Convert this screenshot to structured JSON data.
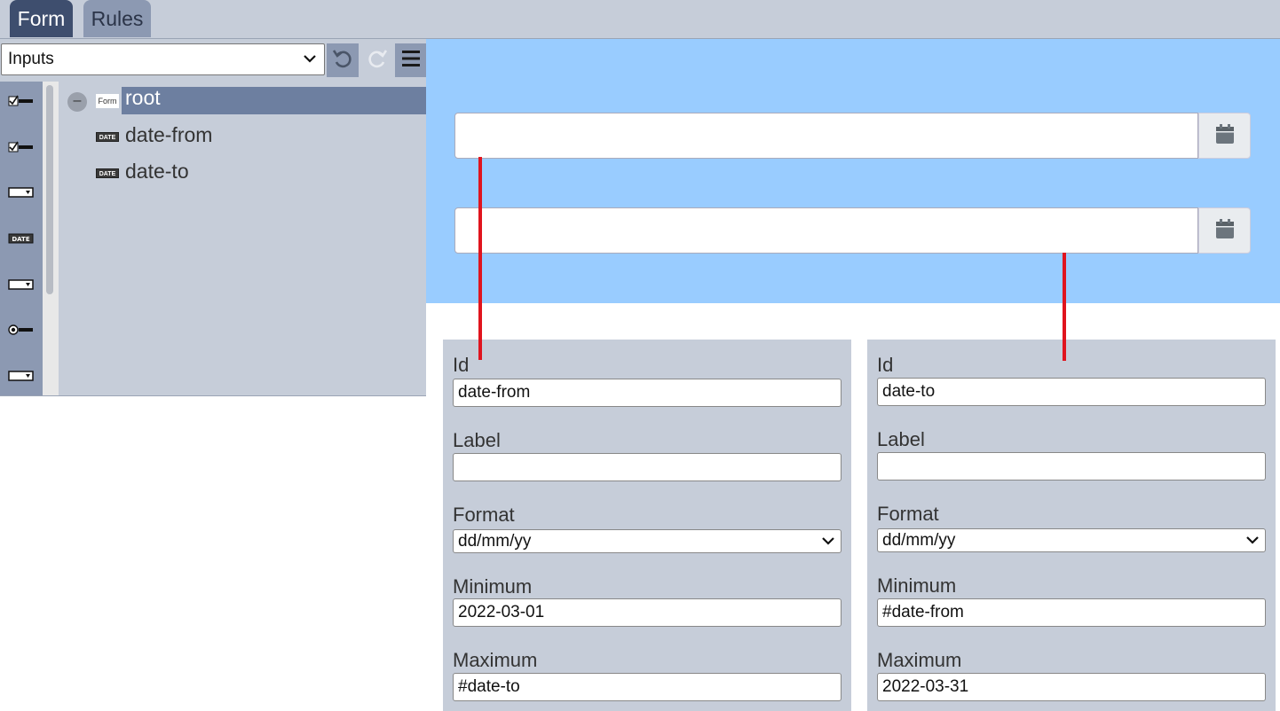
{
  "tabs": [
    {
      "label": "Form",
      "active": true
    },
    {
      "label": "Rules",
      "active": false
    }
  ],
  "toolbar": {
    "inputs_select": "Inputs",
    "undo_icon": "undo-icon",
    "redo_icon": "redo-icon",
    "menu_icon": "hamburger-menu-icon"
  },
  "palette": [
    "checkbox-input-icon",
    "checkbox-input-icon",
    "select-input-icon",
    "date-input-icon",
    "select-input-icon",
    "radio-input-icon",
    "select-input-icon"
  ],
  "tree": {
    "root": {
      "badge": "Form",
      "label": "root"
    },
    "children": [
      {
        "badge": "DATE",
        "label": "date-from"
      },
      {
        "badge": "DATE",
        "label": "date-to"
      }
    ]
  },
  "preview": {
    "date_from_value": "",
    "date_to_value": "",
    "calendar_icon": "calendar-icon"
  },
  "properties": [
    {
      "id_label": "Id",
      "id_value": "date-from",
      "label_label": "Label",
      "label_value": "",
      "format_label": "Format",
      "format_value": "dd/mm/yy",
      "min_label": "Minimum",
      "min_value": "2022-03-01",
      "max_label": "Maximum",
      "max_value": "#date-to"
    },
    {
      "id_label": "Id",
      "id_value": "date-to",
      "label_label": "Label",
      "label_value": "",
      "format_label": "Format",
      "format_value": "dd/mm/yy",
      "min_label": "Minimum",
      "min_value": "#date-from",
      "max_label": "Maximum",
      "max_value": "2022-03-31"
    }
  ],
  "colors": {
    "tab_active": "#3e4e6e",
    "panel_bg": "#c6cdd9",
    "preview_bg": "#99ccff",
    "connector": "#e0141e",
    "selection": "#6d7fa0"
  }
}
